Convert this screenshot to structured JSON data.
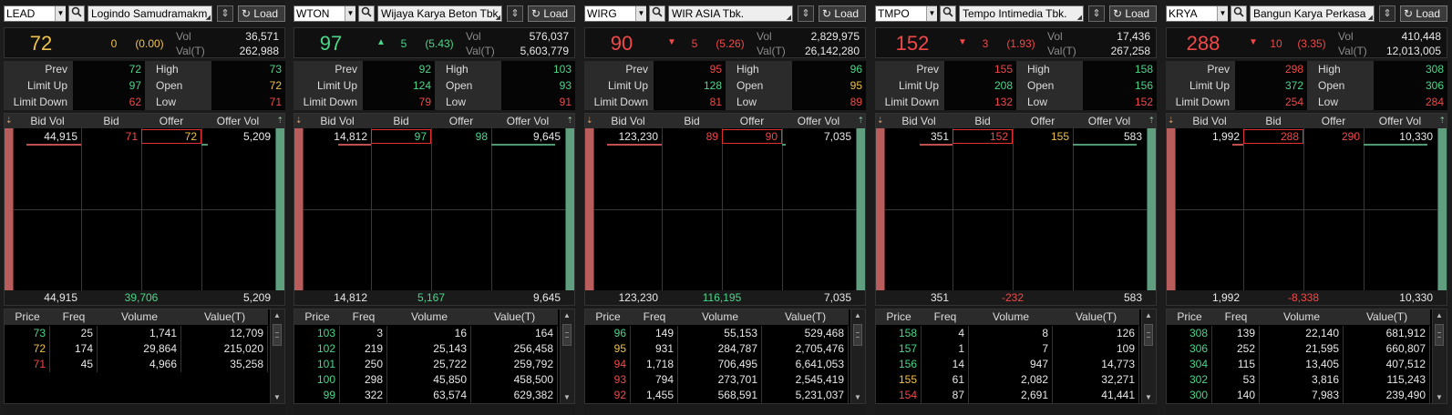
{
  "colors": {
    "up": "#4cd68a",
    "down": "#f24848",
    "unchanged": "#f0c24a"
  },
  "labels": {
    "load": "Load",
    "vol": "Vol",
    "valt": "Val(T)",
    "prev": "Prev",
    "high": "High",
    "limit_up": "Limit Up",
    "open": "Open",
    "limit_down": "Limit Down",
    "low": "Low",
    "bid_vol": "Bid Vol",
    "bid": "Bid",
    "offer": "Offer",
    "offer_vol": "Offer Vol",
    "price": "Price",
    "freq": "Freq",
    "volume": "Volume",
    "value_t": "Value(T)"
  },
  "panels": [
    {
      "ticker": "LEAD",
      "name": "Logindo Samudramakm",
      "last": "72",
      "last_dir": "uc",
      "arrow": "",
      "change": "0",
      "percent": "(0.00)",
      "change_dir": "uc",
      "vol": "36,571",
      "valt": "262,988",
      "prev": "72",
      "high": "73",
      "high_dir": "up",
      "limit_up": "97",
      "open": "72",
      "open_dir": "uc",
      "limit_down": "62",
      "low": "71",
      "low_dir": "dn",
      "bid_vol": "44,915",
      "bid": "71",
      "bid_dir": "dn",
      "offer": "72",
      "offer_dir": "uc",
      "offer_vol": "5,209",
      "boxed": "offer",
      "bid_bar_ratio": 1.0,
      "offer_bar_ratio": 0.1,
      "total_bid_vol": "44,915",
      "net": "39,706",
      "net_dir": "up",
      "total_offer_vol": "5,209",
      "trades": [
        {
          "price": "73",
          "dir": "up",
          "freq": "25",
          "volume": "1,741",
          "value": "12,709"
        },
        {
          "price": "72",
          "dir": "uc",
          "freq": "174",
          "volume": "29,864",
          "value": "215,020"
        },
        {
          "price": "71",
          "dir": "dn",
          "freq": "45",
          "volume": "4,966",
          "value": "35,258"
        }
      ]
    },
    {
      "ticker": "WTON",
      "name": "Wijaya Karya Beton Tbk",
      "last": "97",
      "last_dir": "up",
      "arrow": "▲",
      "change": "5",
      "percent": "(5.43)",
      "change_dir": "up",
      "vol": "576,037",
      "valt": "5,603,779",
      "prev": "92",
      "high": "103",
      "high_dir": "up",
      "limit_up": "124",
      "open": "93",
      "open_dir": "up",
      "limit_down": "79",
      "low": "91",
      "low_dir": "dn",
      "bid_vol": "14,812",
      "bid": "97",
      "bid_dir": "up",
      "offer": "98",
      "offer_dir": "up",
      "offer_vol": "9,645",
      "boxed": "bid",
      "bid_bar_ratio": 0.6,
      "offer_bar_ratio": 1.0,
      "total_bid_vol": "14,812",
      "net": "5,167",
      "net_dir": "up",
      "total_offer_vol": "9,645",
      "trades": [
        {
          "price": "103",
          "dir": "up",
          "freq": "3",
          "volume": "16",
          "value": "164"
        },
        {
          "price": "102",
          "dir": "up",
          "freq": "219",
          "volume": "25,143",
          "value": "256,458"
        },
        {
          "price": "101",
          "dir": "up",
          "freq": "250",
          "volume": "25,722",
          "value": "259,792"
        },
        {
          "price": "100",
          "dir": "up",
          "freq": "298",
          "volume": "45,850",
          "value": "458,500"
        },
        {
          "price": "99",
          "dir": "up",
          "freq": "322",
          "volume": "63,574",
          "value": "629,382"
        }
      ]
    },
    {
      "ticker": "WIRG",
      "name": "WIR ASIA Tbk.",
      "last": "90",
      "last_dir": "dn",
      "arrow": "▼",
      "change": "5",
      "percent": "(5.26)",
      "change_dir": "dn",
      "vol": "2,829,975",
      "valt": "26,142,280",
      "prev": "95",
      "high": "96",
      "high_dir": "up",
      "limit_up": "128",
      "open": "95",
      "open_dir": "uc",
      "limit_down": "81",
      "low": "89",
      "low_dir": "dn",
      "bid_vol": "123,230",
      "bid": "89",
      "bid_dir": "dn",
      "offer": "90",
      "offer_dir": "dn",
      "offer_vol": "7,035",
      "boxed": "offer",
      "bid_bar_ratio": 1.0,
      "offer_bar_ratio": 0.05,
      "total_bid_vol": "123,230",
      "net": "116,195",
      "net_dir": "up",
      "total_offer_vol": "7,035",
      "trades": [
        {
          "price": "96",
          "dir": "up",
          "freq": "149",
          "volume": "55,153",
          "value": "529,468"
        },
        {
          "price": "95",
          "dir": "uc",
          "freq": "931",
          "volume": "284,787",
          "value": "2,705,476"
        },
        {
          "price": "94",
          "dir": "dn",
          "freq": "1,718",
          "volume": "706,495",
          "value": "6,641,053"
        },
        {
          "price": "93",
          "dir": "dn",
          "freq": "794",
          "volume": "273,701",
          "value": "2,545,419"
        },
        {
          "price": "92",
          "dir": "dn",
          "freq": "1,455",
          "volume": "568,591",
          "value": "5,231,037"
        }
      ]
    },
    {
      "ticker": "TMPO",
      "name": "Tempo Intimedia Tbk.",
      "last": "152",
      "last_dir": "dn",
      "arrow": "▼",
      "change": "3",
      "percent": "(1.93)",
      "change_dir": "dn",
      "vol": "17,436",
      "valt": "267,258",
      "prev": "155",
      "high": "158",
      "high_dir": "up",
      "limit_up": "208",
      "open": "156",
      "open_dir": "up",
      "limit_down": "132",
      "low": "152",
      "low_dir": "dn",
      "bid_vol": "351",
      "bid": "152",
      "bid_dir": "dn",
      "offer": "155",
      "offer_dir": "uc",
      "offer_vol": "583",
      "boxed": "bid",
      "bid_bar_ratio": 0.6,
      "offer_bar_ratio": 1.0,
      "total_bid_vol": "351",
      "net": "-232",
      "net_dir": "dn",
      "total_offer_vol": "583",
      "trades": [
        {
          "price": "158",
          "dir": "up",
          "freq": "4",
          "volume": "8",
          "value": "126"
        },
        {
          "price": "157",
          "dir": "up",
          "freq": "1",
          "volume": "7",
          "value": "109"
        },
        {
          "price": "156",
          "dir": "up",
          "freq": "14",
          "volume": "947",
          "value": "14,773"
        },
        {
          "price": "155",
          "dir": "uc",
          "freq": "61",
          "volume": "2,082",
          "value": "32,271"
        },
        {
          "price": "154",
          "dir": "dn",
          "freq": "87",
          "volume": "2,691",
          "value": "41,441"
        }
      ]
    },
    {
      "ticker": "KRYA",
      "name": "Bangun Karya Perkasa",
      "last": "288",
      "last_dir": "dn",
      "arrow": "▼",
      "change": "10",
      "percent": "(3.35)",
      "change_dir": "dn",
      "vol": "410,448",
      "valt": "12,013,005",
      "prev": "298",
      "high": "308",
      "high_dir": "up",
      "limit_up": "372",
      "open": "306",
      "open_dir": "up",
      "limit_down": "254",
      "low": "284",
      "low_dir": "dn",
      "bid_vol": "1,992",
      "bid": "288",
      "bid_dir": "dn",
      "offer": "290",
      "offer_dir": "dn",
      "offer_vol": "10,330",
      "boxed": "bid",
      "bid_bar_ratio": 0.2,
      "offer_bar_ratio": 1.0,
      "total_bid_vol": "1,992",
      "net": "-8,338",
      "net_dir": "dn",
      "total_offer_vol": "10,330",
      "trades": [
        {
          "price": "308",
          "dir": "up",
          "freq": "139",
          "volume": "22,140",
          "value": "681,912"
        },
        {
          "price": "306",
          "dir": "up",
          "freq": "252",
          "volume": "21,595",
          "value": "660,807"
        },
        {
          "price": "304",
          "dir": "up",
          "freq": "115",
          "volume": "13,405",
          "value": "407,512"
        },
        {
          "price": "302",
          "dir": "up",
          "freq": "53",
          "volume": "3,816",
          "value": "115,243"
        },
        {
          "price": "300",
          "dir": "up",
          "freq": "140",
          "volume": "7,983",
          "value": "239,490"
        }
      ]
    }
  ]
}
